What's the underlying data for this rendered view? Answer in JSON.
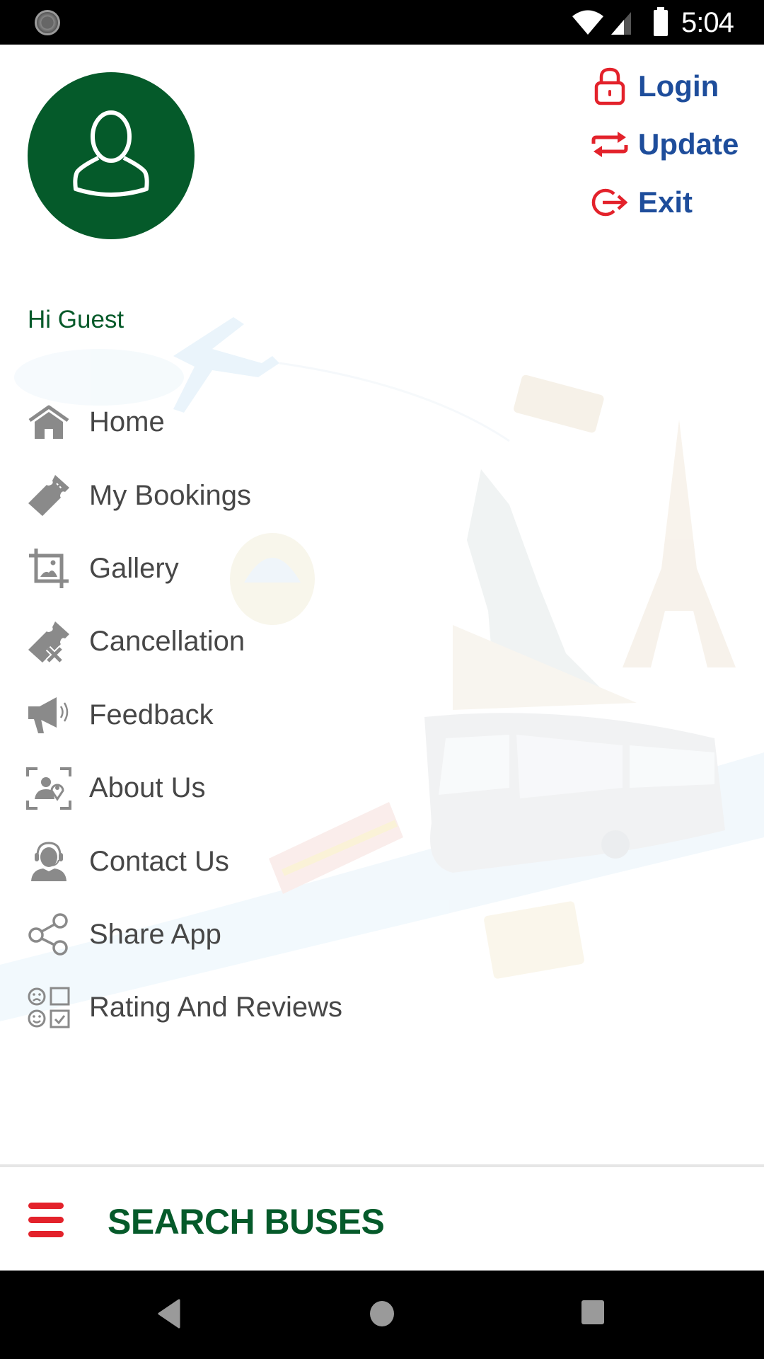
{
  "status_bar": {
    "time": "5:04",
    "icons": [
      "loading-spinner-icon",
      "wifi-icon",
      "cellular-signal-icon",
      "battery-icon"
    ]
  },
  "colors": {
    "brand_green": "#055a2a",
    "accent_red": "#e3222b",
    "action_blue": "#1e4d9b",
    "menu_text": "#474747",
    "menu_icon": "#8a8a8a"
  },
  "header": {
    "avatar_icon": "user-outline-icon",
    "greeting": "Hi Guest",
    "actions": [
      {
        "label": "Login",
        "icon": "lock-icon"
      },
      {
        "label": "Update",
        "icon": "swap-arrows-icon"
      },
      {
        "label": "Exit",
        "icon": "logout-icon"
      }
    ]
  },
  "menu": {
    "items": [
      {
        "label": "Home",
        "icon": "home-icon"
      },
      {
        "label": "My Bookings",
        "icon": "ticket-icon"
      },
      {
        "label": "Gallery",
        "icon": "image-crop-icon"
      },
      {
        "label": "Cancellation",
        "icon": "ticket-cancel-icon"
      },
      {
        "label": "Feedback",
        "icon": "megaphone-icon"
      },
      {
        "label": "About Us",
        "icon": "person-location-icon"
      },
      {
        "label": "Contact Us",
        "icon": "headset-person-icon"
      },
      {
        "label": "Share App",
        "icon": "share-icon"
      },
      {
        "label": "Rating And Reviews",
        "icon": "rating-review-icon"
      }
    ]
  },
  "bottom_bar": {
    "menu_icon": "hamburger-menu-icon",
    "title": "SEARCH BUSES"
  },
  "nav_bar": {
    "buttons": [
      "back-icon",
      "home-circle-icon",
      "recents-icon"
    ]
  }
}
